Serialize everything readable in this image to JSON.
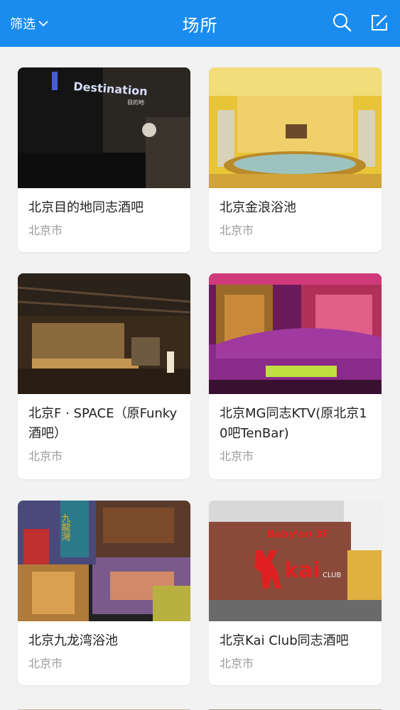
{
  "header": {
    "filter_label": "筛选",
    "title": "场所",
    "search_icon": "search-icon",
    "edit_icon": "edit-icon"
  },
  "venues": [
    {
      "name": "北京目的地同志酒吧",
      "city": "北京市",
      "sign_text": "Destination",
      "sign_sub": "目的地"
    },
    {
      "name": "北京金浪浴池",
      "city": "北京市"
    },
    {
      "name": "北京F · SPACE（原Funky酒吧）",
      "city": "北京市"
    },
    {
      "name": "北京MG同志KTV(原北京10吧TenBar)",
      "city": "北京市"
    },
    {
      "name": "北京九龙湾浴池",
      "city": "北京市",
      "sign_text": "九龍灣"
    },
    {
      "name": "北京Kai Club同志酒吧",
      "city": "北京市",
      "sign_text": "kai",
      "sign_sub": "CLUB",
      "sign_top": "Baby'on 3F"
    }
  ],
  "colors": {
    "header_bg": "#1a8cf0",
    "page_bg": "#f2f2f2",
    "name_text": "#222222",
    "city_text": "#9a9a9a"
  }
}
